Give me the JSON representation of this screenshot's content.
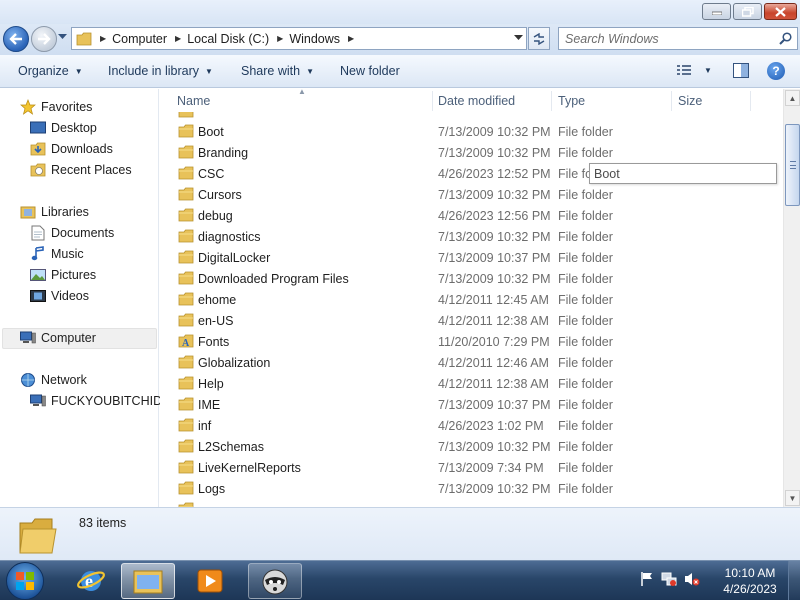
{
  "window": {
    "controls": {
      "minimize": "minimize-icon",
      "maximize": "maximize-icon",
      "close": "close-icon"
    }
  },
  "address": {
    "crumbs": [
      "Computer",
      "Local Disk (C:)",
      "Windows"
    ],
    "search_placeholder": "Search Windows"
  },
  "toolbar": {
    "organize": "Organize",
    "include_in_library": "Include in library",
    "share_with": "Share with",
    "new_folder": "New folder"
  },
  "nav": {
    "favorites": "Favorites",
    "desktop": "Desktop",
    "downloads": "Downloads",
    "recent_places": "Recent Places",
    "libraries": "Libraries",
    "documents": "Documents",
    "music": "Music",
    "pictures": "Pictures",
    "videos": "Videos",
    "computer": "Computer",
    "network": "Network",
    "network_pc": "FUCKYOUBITCHIDI"
  },
  "columns": {
    "name": "Name",
    "date_modified": "Date modified",
    "type": "Type",
    "size": "Size"
  },
  "files": [
    {
      "name": "Boot",
      "date": "7/13/2009 10:32 PM",
      "type": "File folder"
    },
    {
      "name": "Branding",
      "date": "7/13/2009 10:32 PM",
      "type": "File folder"
    },
    {
      "name": "CSC",
      "date": "4/26/2023 12:52 PM",
      "type": "File folder"
    },
    {
      "name": "Cursors",
      "date": "7/13/2009 10:32 PM",
      "type": "File folder"
    },
    {
      "name": "debug",
      "date": "4/26/2023 12:56 PM",
      "type": "File folder"
    },
    {
      "name": "diagnostics",
      "date": "7/13/2009 10:32 PM",
      "type": "File folder"
    },
    {
      "name": "DigitalLocker",
      "date": "7/13/2009 10:37 PM",
      "type": "File folder"
    },
    {
      "name": "Downloaded Program Files",
      "date": "7/13/2009 10:32 PM",
      "type": "File folder"
    },
    {
      "name": "ehome",
      "date": "4/12/2011 12:45 AM",
      "type": "File folder"
    },
    {
      "name": "en-US",
      "date": "4/12/2011 12:38 AM",
      "type": "File folder"
    },
    {
      "name": "Fonts",
      "date": "11/20/2010 7:29 PM",
      "type": "File folder"
    },
    {
      "name": "Globalization",
      "date": "4/12/2011 12:46 AM",
      "type": "File folder"
    },
    {
      "name": "Help",
      "date": "4/12/2011 12:38 AM",
      "type": "File folder"
    },
    {
      "name": "IME",
      "date": "7/13/2009 10:37 PM",
      "type": "File folder"
    },
    {
      "name": "inf",
      "date": "4/26/2023 1:02 PM",
      "type": "File folder"
    },
    {
      "name": "L2Schemas",
      "date": "7/13/2009 10:32 PM",
      "type": "File folder"
    },
    {
      "name": "LiveKernelReports",
      "date": "7/13/2009 7:34 PM",
      "type": "File folder"
    },
    {
      "name": "Logs",
      "date": "7/13/2009 10:32 PM",
      "type": "File folder"
    }
  ],
  "tooltip": "Boot",
  "details": {
    "count": "83 items"
  },
  "taskbar": {
    "items": [
      "internet-explorer-icon",
      "windows-explorer-icon",
      "media-player-icon",
      "raccoon-app-icon"
    ],
    "time": "10:10 AM",
    "date": "4/26/2023"
  },
  "colors": {
    "accent": "#1e395b",
    "folder": "#e8c25a",
    "taskbar": "#294669"
  }
}
